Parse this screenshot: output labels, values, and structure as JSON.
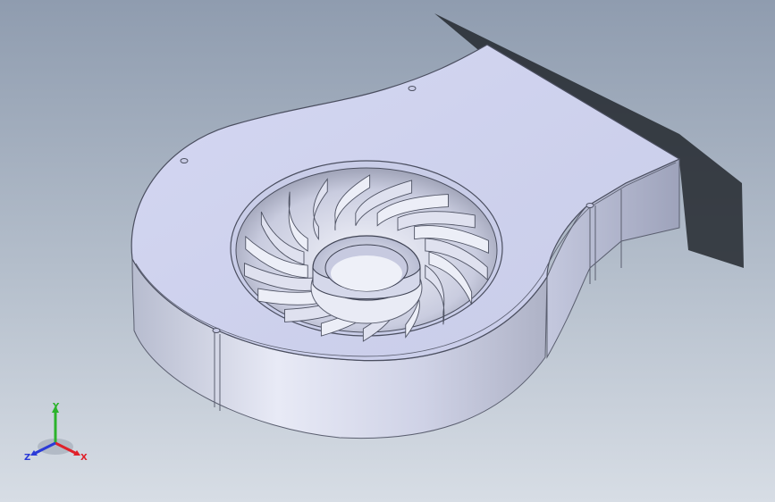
{
  "viewport": {
    "background_top": "#8f9caf",
    "background_bottom": "#d7dde5"
  },
  "model": {
    "description_icon": "centrifugal-blower-housing",
    "body_color": "#d5d8f0",
    "top_color": "#cfd3ee",
    "shadow_color": "#2a2f36",
    "impeller_blade_count": 18
  },
  "triad": {
    "x_label": "X",
    "y_label": "Y",
    "z_label": "Z",
    "x_color": "#e0202a",
    "y_color": "#2bb32b",
    "z_color": "#2a3ad8"
  }
}
